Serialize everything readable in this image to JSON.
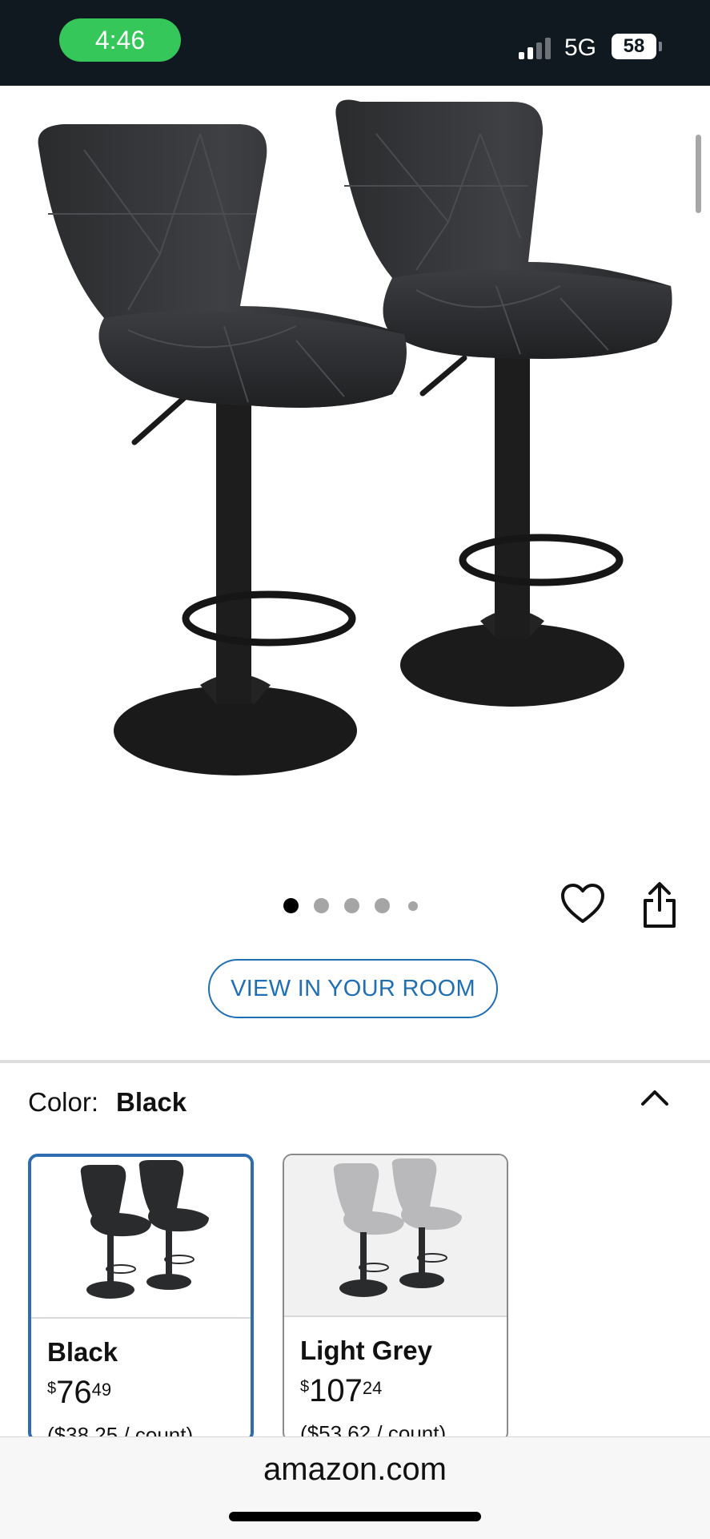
{
  "status_bar": {
    "time": "4:46",
    "network": "5G",
    "battery": "58",
    "time_pill_color": "#35c759"
  },
  "gallery": {
    "image_count": 5,
    "active_index": 0,
    "icons": [
      "heart-icon",
      "share-icon"
    ]
  },
  "view_in_room": {
    "label": "VIEW IN YOUR ROOM"
  },
  "color": {
    "label": "Color:",
    "selected": "Black"
  },
  "options": [
    {
      "name": "Black",
      "currency": "$",
      "whole": "76",
      "fraction": "49",
      "per_count": "($38.25 / count)"
    },
    {
      "name": "Light Grey",
      "currency": "$",
      "whole": "107",
      "fraction": "24",
      "per_count": "($53.62 / count)"
    }
  ],
  "browser": {
    "url": "amazon.com"
  },
  "colors": {
    "link_blue": "#1f6fb5",
    "selected_border": "#2f6cb0"
  }
}
